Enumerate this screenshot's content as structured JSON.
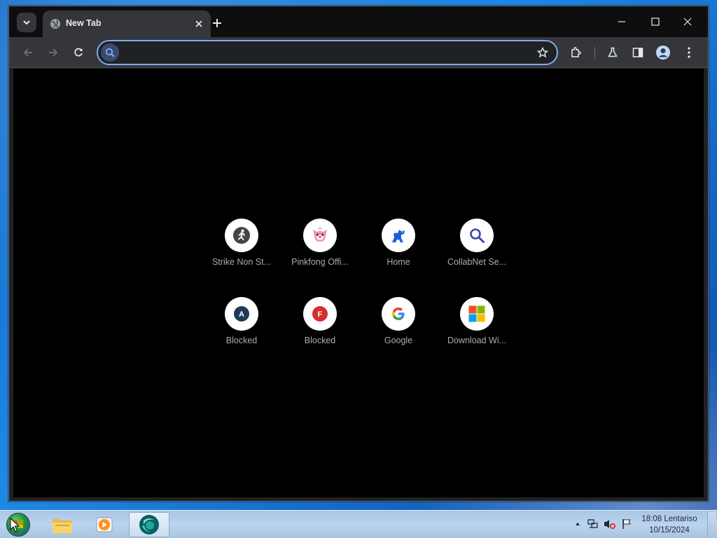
{
  "browser": {
    "tab_title": "New Tab",
    "omnibox": {
      "value": "",
      "placeholder": ""
    }
  },
  "shortcuts": [
    {
      "label": "Strike Non St...",
      "icon": "strike-person-icon"
    },
    {
      "label": "Pinkfong Offi...",
      "icon": "pinkfong-icon"
    },
    {
      "label": "Home",
      "icon": "dinosaur-icon"
    },
    {
      "label": "CollabNet Se...",
      "icon": "magnifier-icon"
    },
    {
      "label": "Blocked",
      "icon": "letter-a-icon",
      "letter": "A",
      "color": "#1f3b58"
    },
    {
      "label": "Blocked",
      "icon": "letter-f-icon",
      "letter": "F",
      "color": "#d32f2f"
    },
    {
      "label": "Google",
      "icon": "google-icon"
    },
    {
      "label": "Download Wi...",
      "icon": "microsoft-icon"
    }
  ],
  "taskbar": {
    "clock_time": "18:08 Lentariso",
    "clock_date": "10/15/2024"
  },
  "colors": {
    "accent": "#7cacf8",
    "toolbar": "#35363a",
    "page_bg": "#000000"
  }
}
